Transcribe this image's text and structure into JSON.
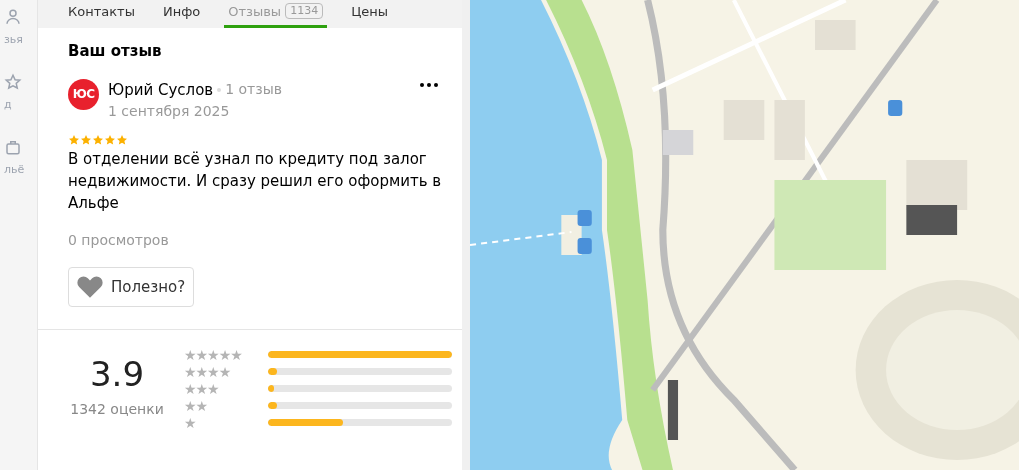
{
  "sidebar": {
    "items": [
      {
        "label": "зья",
        "kind": "people"
      },
      {
        "label": "д",
        "kind": "star"
      },
      {
        "label": "льё",
        "kind": "bag"
      }
    ]
  },
  "tabs": [
    {
      "label": "Контакты",
      "selected": false
    },
    {
      "label": "Инфо",
      "selected": false
    },
    {
      "label": "Отзывы",
      "count": "1134",
      "selected": true
    },
    {
      "label": "Цены",
      "selected": false
    }
  ],
  "your_review": {
    "heading": "Ваш отзыв",
    "avatar": "ЮС",
    "author": "Юрий Суслов",
    "author_reviews": "1 отзыв",
    "date": "1 сентября 2025",
    "stars": 5,
    "text": "В отделении всё узнал по кредиту под залог недвижимости. И сразу решил его оформить в Альфе",
    "views": "0 просмотров",
    "helpful_button": "Полезно?"
  },
  "rating_summary": {
    "score": "3.9",
    "count": "1342 оценки",
    "rows": [
      {
        "label": "★★★★★",
        "level": 1.0
      },
      {
        "label": "★★★★",
        "level": 0.05
      },
      {
        "label": "★★★",
        "level": 0.02
      },
      {
        "label": "★★",
        "level": 0.05
      },
      {
        "label": "★",
        "level": 0.41
      }
    ]
  }
}
